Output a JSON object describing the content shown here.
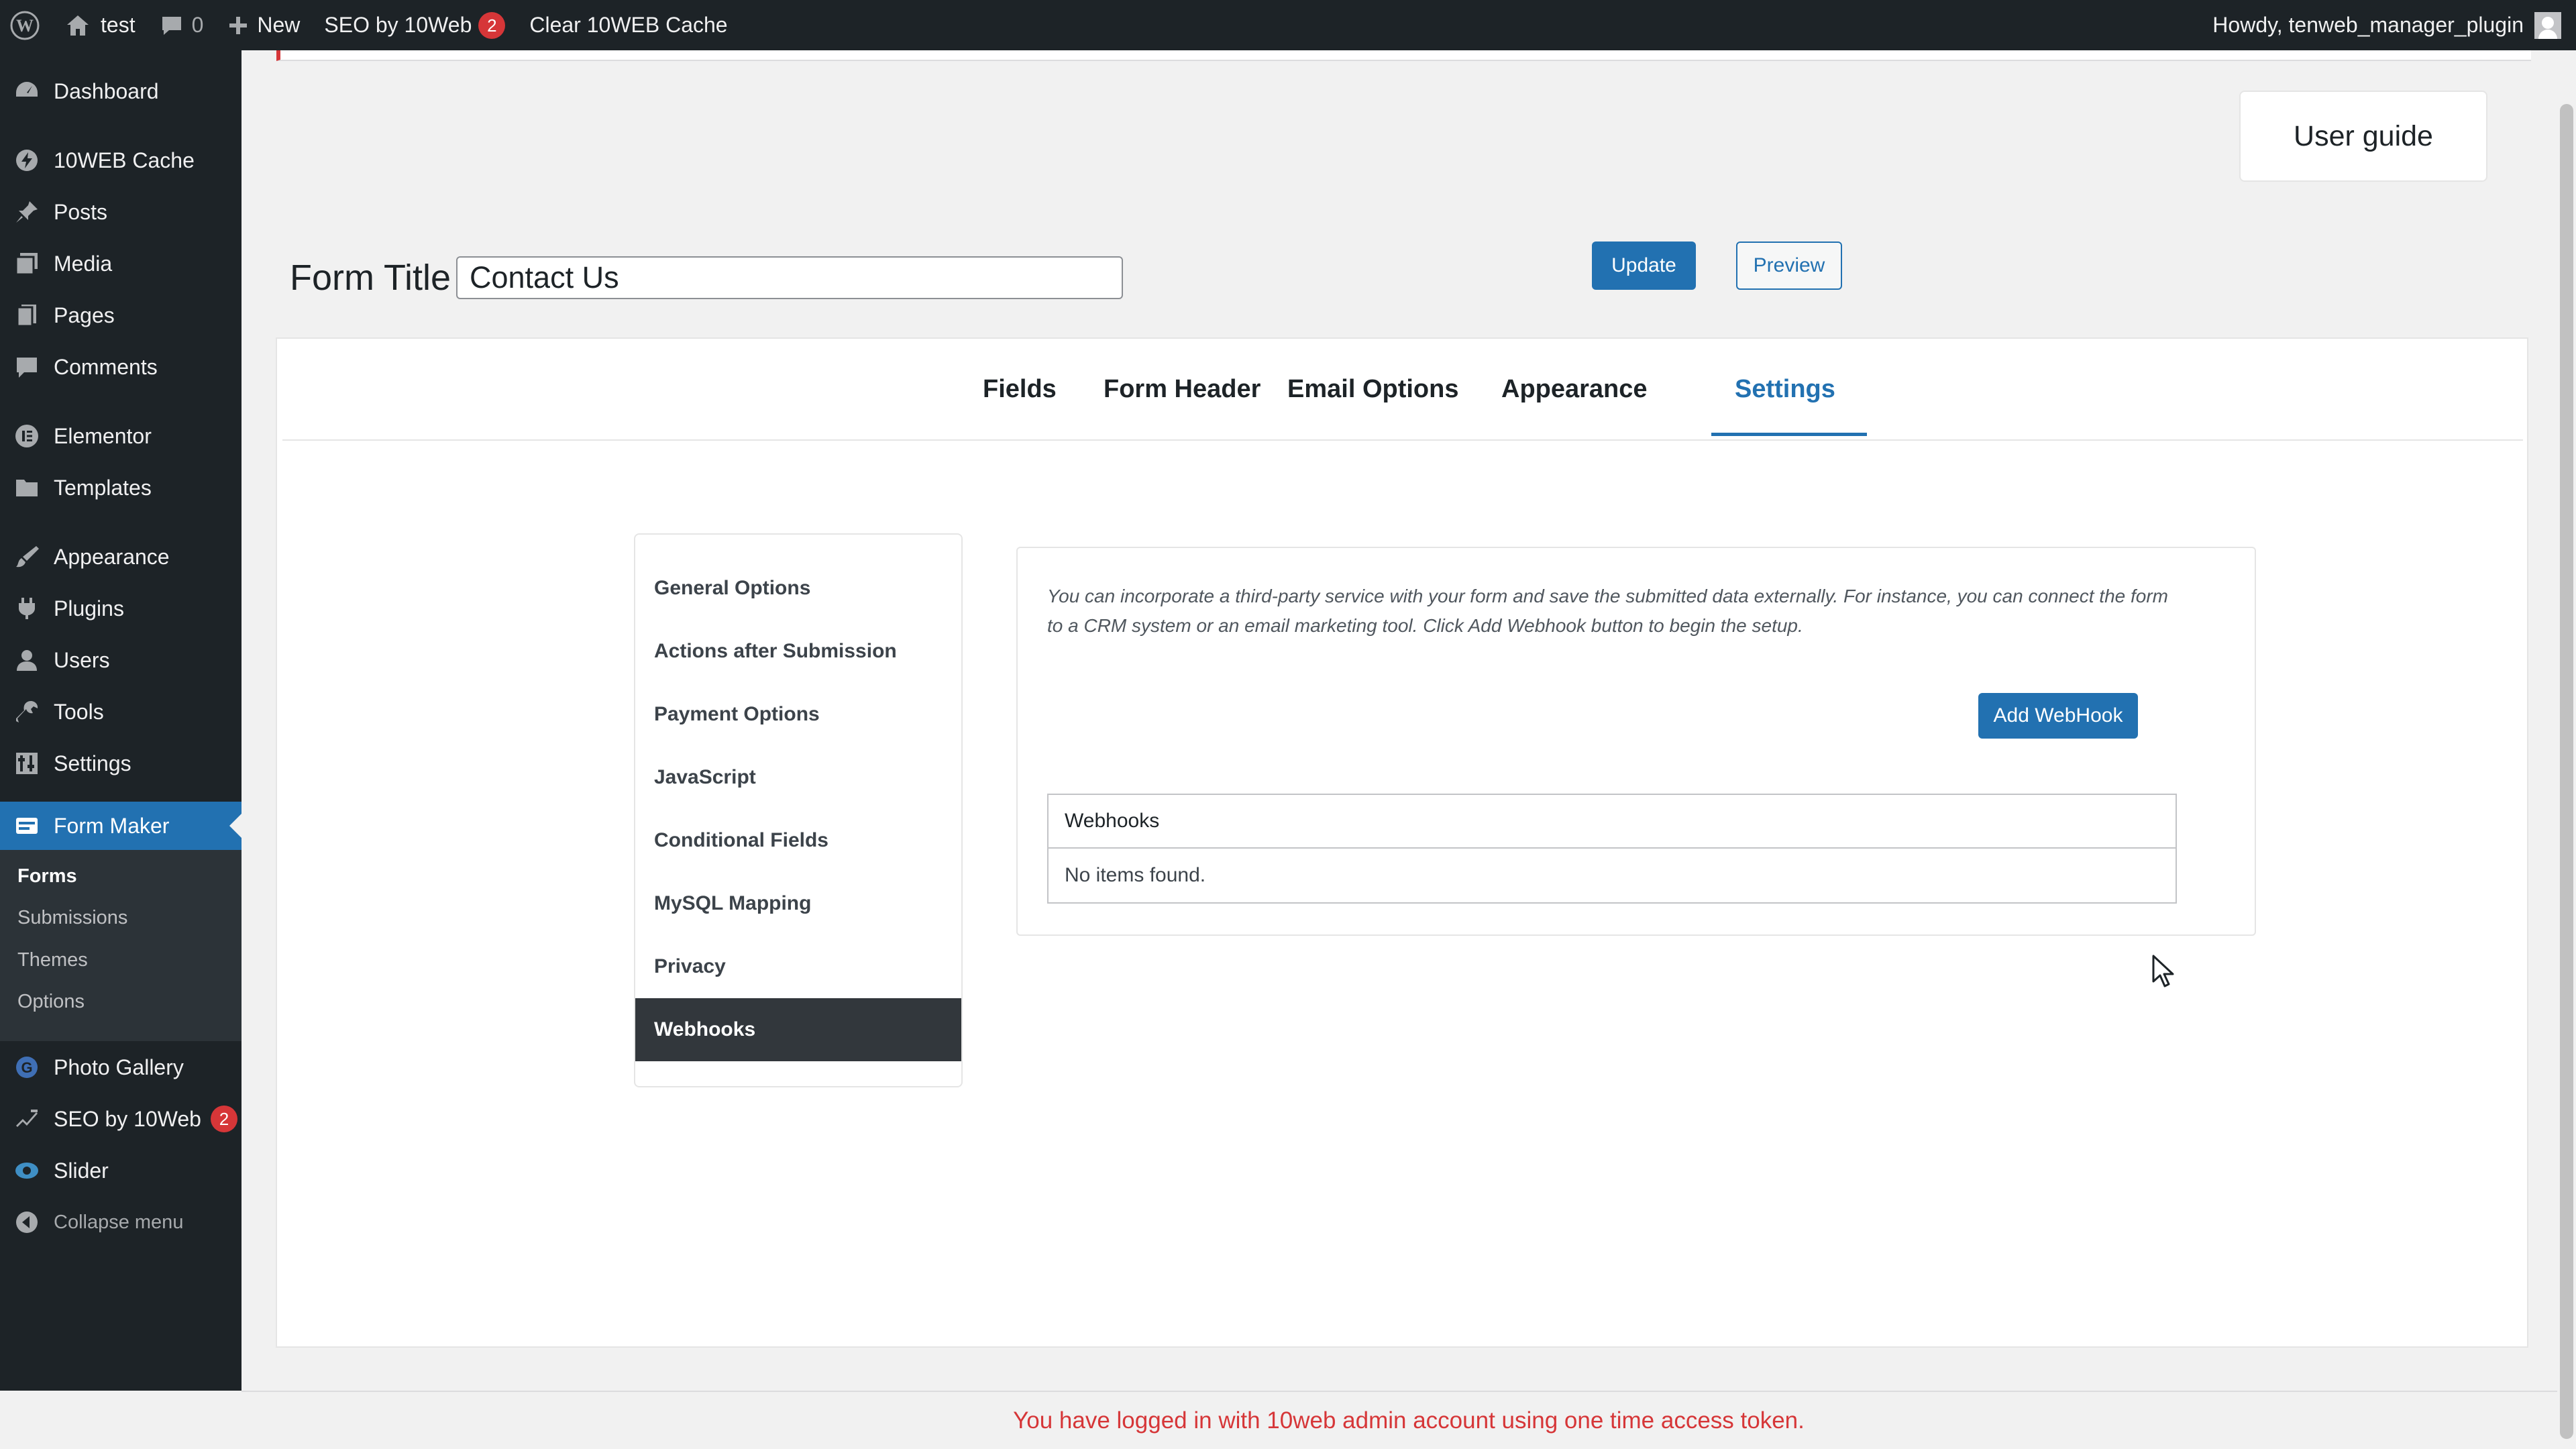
{
  "adminbar": {
    "site_name": "test",
    "comments_count": "0",
    "new_label": "New",
    "seo_label": "SEO by 10Web",
    "seo_badge": "2",
    "clear_cache_label": "Clear 10WEB Cache",
    "howdy": "Howdy, tenweb_manager_plugin"
  },
  "sidebar": {
    "items": [
      {
        "label": "Dashboard",
        "icon": "dashboard-icon"
      },
      {
        "label": "10WEB Cache",
        "icon": "cache-icon"
      },
      {
        "label": "Posts",
        "icon": "pin-icon"
      },
      {
        "label": "Media",
        "icon": "media-icon"
      },
      {
        "label": "Pages",
        "icon": "pages-icon"
      },
      {
        "label": "Comments",
        "icon": "comment-icon"
      },
      {
        "label": "Elementor",
        "icon": "elementor-icon"
      },
      {
        "label": "Templates",
        "icon": "folder-icon"
      },
      {
        "label": "Appearance",
        "icon": "brush-icon"
      },
      {
        "label": "Plugins",
        "icon": "plug-icon"
      },
      {
        "label": "Users",
        "icon": "user-icon"
      },
      {
        "label": "Tools",
        "icon": "wrench-icon"
      },
      {
        "label": "Settings",
        "icon": "settings-icon"
      },
      {
        "label": "Form Maker",
        "icon": "form-icon"
      },
      {
        "label": "Photo Gallery",
        "icon": "gallery-icon"
      },
      {
        "label": "SEO by 10Web",
        "icon": "seo-icon",
        "badge": "2"
      },
      {
        "label": "Slider",
        "icon": "slider-icon"
      },
      {
        "label": "Collapse menu",
        "icon": "collapse-icon"
      }
    ],
    "submenu": [
      "Forms",
      "Submissions",
      "Themes",
      "Options"
    ]
  },
  "main": {
    "user_guide": "User guide",
    "form_title_label": "Form Title",
    "form_title_value": "Contact Us",
    "update_label": "Update",
    "preview_label": "Preview",
    "tabs": [
      "Fields",
      "Form Header",
      "Email Options",
      "Appearance",
      "Settings"
    ],
    "active_tab": "Settings",
    "settings_nav": [
      "General Options",
      "Actions after Submission",
      "Payment Options",
      "JavaScript",
      "Conditional Fields",
      "MySQL Mapping",
      "Privacy",
      "Webhooks"
    ],
    "active_settings": "Webhooks",
    "webhook_desc": "You can incorporate a third-party service with your form and save the submitted data externally. For instance, you can connect the form to a CRM system or an email marketing tool. Click Add Webhook button to begin the setup.",
    "add_webhook_label": "Add WebHook",
    "table_header": "Webhooks",
    "table_empty": "No items found."
  },
  "footer_notice": "You have logged in with 10web admin account using one time access token.",
  "colors": {
    "admin_dark": "#1d2327",
    "accent_blue": "#2271b1",
    "notice_red": "#d63638",
    "background": "#f1f1f1"
  }
}
